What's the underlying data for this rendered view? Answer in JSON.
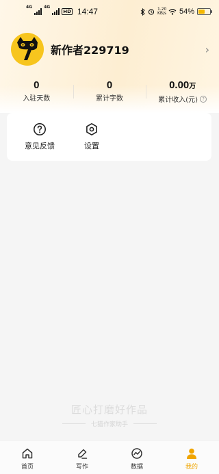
{
  "status_bar": {
    "net1": "4G",
    "net2": "4G",
    "hd": "HD",
    "time": "14:47",
    "net_speed_value": "1.20",
    "net_speed_unit": "KB/s",
    "battery_pct": "54%",
    "battery_level": 0.54
  },
  "profile": {
    "username": "新作者229719"
  },
  "stats": [
    {
      "value": "0",
      "unit": "",
      "label": "入驻天数"
    },
    {
      "value": "0",
      "unit": "",
      "label": "累计字数"
    },
    {
      "value": "0.00",
      "unit": "万",
      "label": "累计收入(元)"
    }
  ],
  "tools": {
    "feedback_label": "意见反馈",
    "settings_label": "设置"
  },
  "slogan": {
    "main": "匠心打磨好作品",
    "sub": "七猫作家助手"
  },
  "tabbar": {
    "home": "首页",
    "write": "写作",
    "data": "数据",
    "mine": "我的",
    "active_color": "#F0A500"
  }
}
